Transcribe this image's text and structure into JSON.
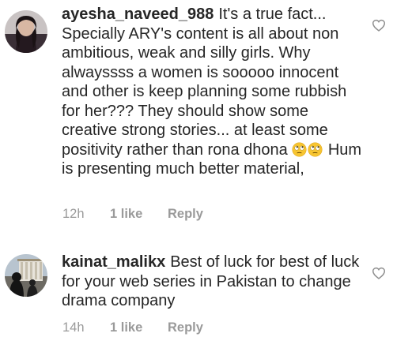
{
  "comments": [
    {
      "username": "ayesha_naveed_988",
      "text_part1": "It's a true fact... Specially ARY's content  is all about non ambitious, weak and silly girls. Why alwayssss a women is sooooo innocent and other is keep planning some rubbish for her??? They should show some creative strong stories... at least some positivity rather than rona dhona",
      "emojis": [
        "face-with-rolling-eyes",
        "face-with-rolling-eyes"
      ],
      "text_part2": "Hum is presenting much better material,",
      "time": "12h",
      "likes": "1 like",
      "reply_label": "Reply",
      "like_icon": "heart-outline-icon"
    },
    {
      "username": "kainat_malikx",
      "text_part1": "Best of luck for best of luck for your web series in Pakistan to change drama company",
      "time": "14h",
      "likes": "1 like",
      "reply_label": "Reply",
      "like_icon": "heart-outline-icon"
    }
  ],
  "colors": {
    "text": "#262626",
    "secondary": "#9a9a9a",
    "heart_stroke": "#8e8e8e",
    "emoji_face": "#f7c531"
  }
}
